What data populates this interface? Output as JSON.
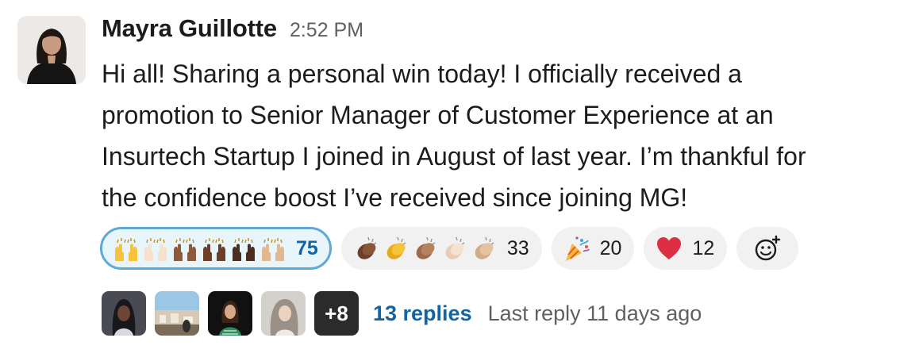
{
  "message": {
    "author": "Mayra Guillotte",
    "timestamp": "2:52 PM",
    "lines": [
      "Hi all! Sharing a personal win today! I officially received a",
      "promotion to Senior Manager of Customer Experience at an",
      "Insurtech Startup I joined in August of last year. I’m thankful for",
      "the confidence boost I’ve received since joining MG!"
    ]
  },
  "reactions": [
    {
      "name": "raised-hands",
      "count": "75",
      "selected": true,
      "icons": [
        "raised-hands-yellow-icon",
        "raised-hands-light-icon",
        "raised-hands-medium-dark-icon",
        "raised-hands-dark-icon",
        "raised-hands-darkest-icon",
        "raised-hands-medium-light-icon"
      ]
    },
    {
      "name": "clap",
      "count": "33",
      "selected": false,
      "icons": [
        "clap-dark-icon",
        "clap-yellow-icon",
        "clap-medium-icon",
        "clap-light-icon",
        "clap-medium-light-icon"
      ]
    },
    {
      "name": "tada",
      "count": "20",
      "selected": false,
      "icons": [
        "party-popper-icon"
      ]
    },
    {
      "name": "heart",
      "count": "12",
      "selected": false,
      "icons": [
        "red-heart-icon"
      ]
    }
  ],
  "add_reaction": {
    "icon": "add-emoji-icon"
  },
  "thread": {
    "more_count": "+8",
    "replies": "13 replies",
    "last_reply": "Last reply 11 days ago"
  },
  "colors": {
    "link": "#1264a3",
    "selected_border": "#5ea9d7",
    "selected_bg": "#e8f5fa",
    "pill_bg": "#f1f1f1",
    "muted": "#616061"
  }
}
